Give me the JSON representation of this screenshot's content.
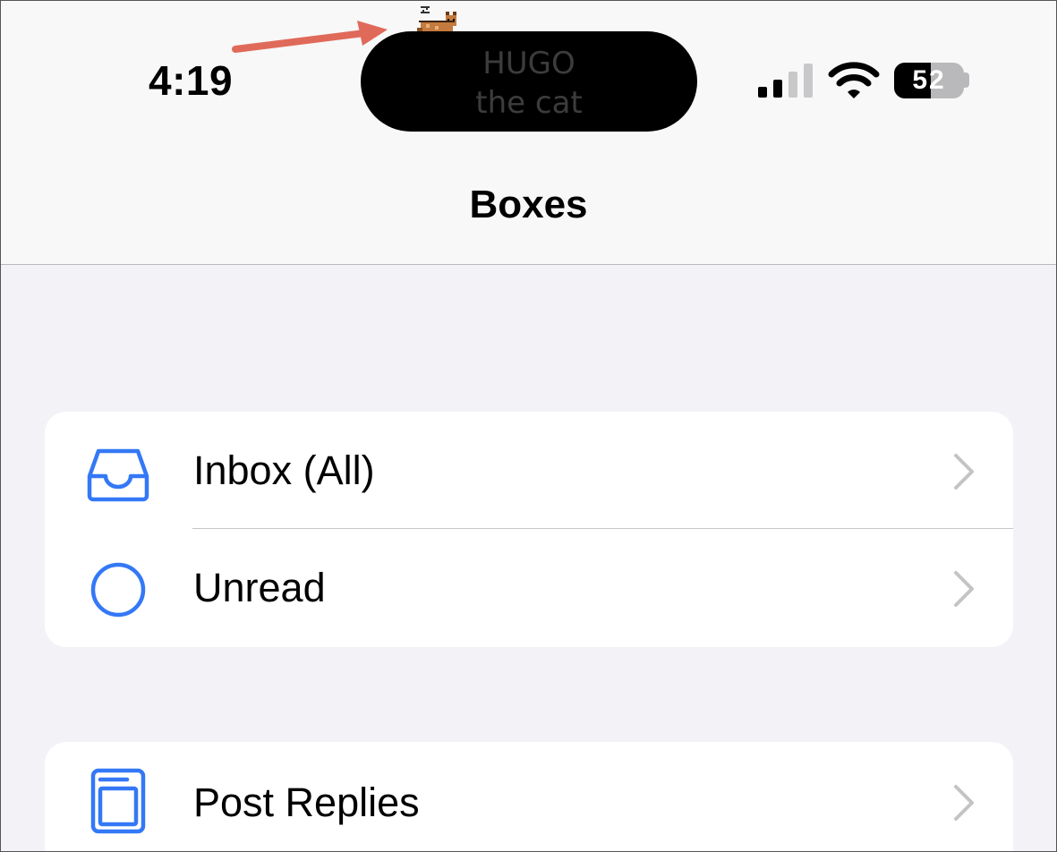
{
  "status_bar": {
    "time": "4:19",
    "island_text_line1": "HUGO",
    "island_text_line2": "the cat",
    "battery_percent": "52",
    "battery_level": 0.52,
    "signal_bars_active": 2,
    "signal_bars_total": 4
  },
  "nav": {
    "title": "Boxes"
  },
  "groups": [
    {
      "rows": [
        {
          "label": "Inbox (All)",
          "icon": "inbox-tray-icon"
        },
        {
          "label": "Unread",
          "icon": "circle-icon"
        }
      ]
    },
    {
      "rows": [
        {
          "label": "Post Replies",
          "icon": "document-tray-icon"
        }
      ]
    }
  ],
  "colors": {
    "accent": "#3478f6",
    "chevron": "#c4c4c7",
    "background": "#f2f2f7",
    "arrow": "#e06a5a"
  },
  "annotation": {
    "icon": "red-arrow-icon"
  }
}
